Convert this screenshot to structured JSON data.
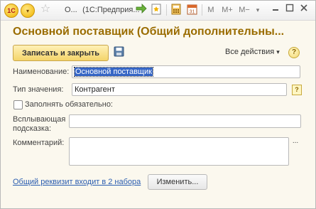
{
  "titlebar": {
    "title_short": "О...",
    "title_app": "(1С:Предприя...",
    "btn_m": "M",
    "btn_mplus": "M+",
    "btn_mminus": "M−",
    "calendar_day": "31"
  },
  "form": {
    "header": "Основной поставщик (Общий дополнительны...",
    "save_close_label": "Записать и закрыть",
    "all_actions_label": "Все действия",
    "all_actions_arrow": "▾",
    "help_label": "?",
    "name_label": "Наименование:",
    "name_value": "Основной поставщик",
    "value_type_label": "Тип значения:",
    "value_type_value": "Контрагент",
    "value_type_help": "?",
    "required_label": "Заполнять обязательно:",
    "tooltip_label_line1": "Всплывающая",
    "tooltip_label_line2": "подсказка:",
    "tooltip_value": "",
    "comment_label": "Комментарий:",
    "comment_value": "",
    "comment_more": "...",
    "sets_link": "Общий реквизит входит в 2 набора",
    "change_label": "Изменить..."
  },
  "colors": {
    "header": "#9a6c00",
    "accent_button": "#f4d46a",
    "link": "#2a5db0",
    "selection": "#3565c5"
  }
}
